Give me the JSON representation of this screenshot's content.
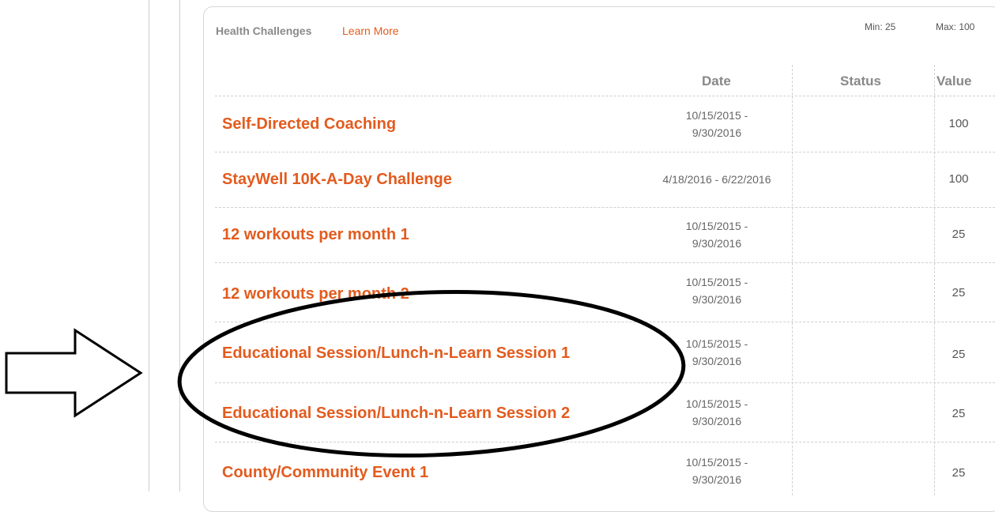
{
  "panel": {
    "title": "Health Challenges",
    "learn_more": "Learn More",
    "min_label": "Min: 25",
    "max_label": "Max: 100"
  },
  "columns": {
    "date": "Date",
    "status": "Status",
    "value": "Value"
  },
  "rows": [
    {
      "name": "Self-Directed Coaching",
      "date_line1": "10/15/2015 -",
      "date_line2": "9/30/2016",
      "status": "",
      "value": "100"
    },
    {
      "name": "StayWell 10K-A-Day Challenge",
      "date_line1": "4/18/2016 - 6/22/2016",
      "date_line2": "",
      "status": "",
      "value": "100"
    },
    {
      "name": "12 workouts per month 1",
      "date_line1": "10/15/2015 -",
      "date_line2": "9/30/2016",
      "status": "",
      "value": "25"
    },
    {
      "name": "12 workouts per month 2",
      "date_line1": "10/15/2015 -",
      "date_line2": "9/30/2016",
      "status": "",
      "value": "25"
    },
    {
      "name": "Educational Session/Lunch-n-Learn Session 1",
      "date_line1": "10/15/2015 -",
      "date_line2": "9/30/2016",
      "status": "",
      "value": "25"
    },
    {
      "name": "Educational Session/Lunch-n-Learn Session 2",
      "date_line1": "10/15/2015 -",
      "date_line2": "9/30/2016",
      "status": "",
      "value": "25"
    },
    {
      "name": "County/Community Event 1",
      "date_line1": "10/15/2015 -",
      "date_line2": "9/30/2016",
      "status": "",
      "value": "25"
    }
  ],
  "colors": {
    "accent": "#e35b1e",
    "muted_text": "#888888",
    "annotation": "#000000"
  }
}
